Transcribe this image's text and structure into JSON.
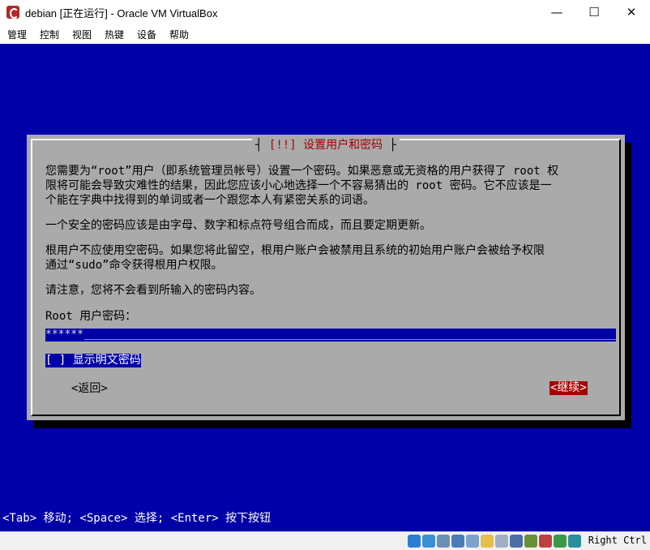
{
  "window": {
    "title": "debian [正在运行] - Oracle VM VirtualBox",
    "minimize": "—",
    "maximize": "☐",
    "close": "✕"
  },
  "menu": [
    "管理",
    "控制",
    "视图",
    "热键",
    "设备",
    "帮助"
  ],
  "dialog": {
    "title_marker": "[!!]",
    "title": "设置用户和密码",
    "para1_line1": "您需要为“root”用户（即系统管理员帐号）设置一个密码。如果恶意或无资格的用户获得了 root 权",
    "para1_line2": "限将可能会导致灾难性的结果，因此您应该小心地选择一个不容易猜出的 root 密码。它不应该是一",
    "para1_line3": "个能在字典中找得到的单词或者一个跟您本人有紧密关系的词语。",
    "para2": "一个安全的密码应该是由字母、数字和标点符号组合而成，而且要定期更新。",
    "para3_line1": "根用户不应使用空密码。如果您将此留空，根用户账户会被禁用且系统的初始用户账户会被给予权限",
    "para3_line2": "通过“sudo”命令获得根用户权限。",
    "para4": "请注意，您将不会看到所输入的密码内容。",
    "password_label": "Root 用户密码：",
    "password_value": "******",
    "show_password_checkbox": "[ ] 显示明文密码",
    "back_button": "<返回>",
    "continue_button": "<继续>"
  },
  "help_line": "<Tab> 移动; <Space> 选择; <Enter> 按下按钮",
  "status": {
    "host_key": "Right Ctrl",
    "icon_names": [
      "hard-disk-icon",
      "optical-drive-icon",
      "audio-icon",
      "network-icon",
      "usb-icon",
      "shared-folders-icon",
      "display-icon",
      "video-capture-icon",
      "cpu-icon",
      "guest-additions-icon",
      "mouse-integration-icon",
      "keyboard-capture-icon"
    ],
    "icon_colors": [
      "#2a7fd4",
      "#3a8fd6",
      "#6b8fb5",
      "#4a7db8",
      "#7da2c9",
      "#e3c04b",
      "#9fb0c2",
      "#4a6fa5",
      "#6a8f3a",
      "#c04040",
      "#3a9a4a",
      "#2a8f9a"
    ]
  },
  "colors": {
    "screen_bg": "#0000a8",
    "dialog_bg": "#aaaaaa",
    "title_red": "#a80000",
    "selected_button_bg": "#a80000"
  }
}
